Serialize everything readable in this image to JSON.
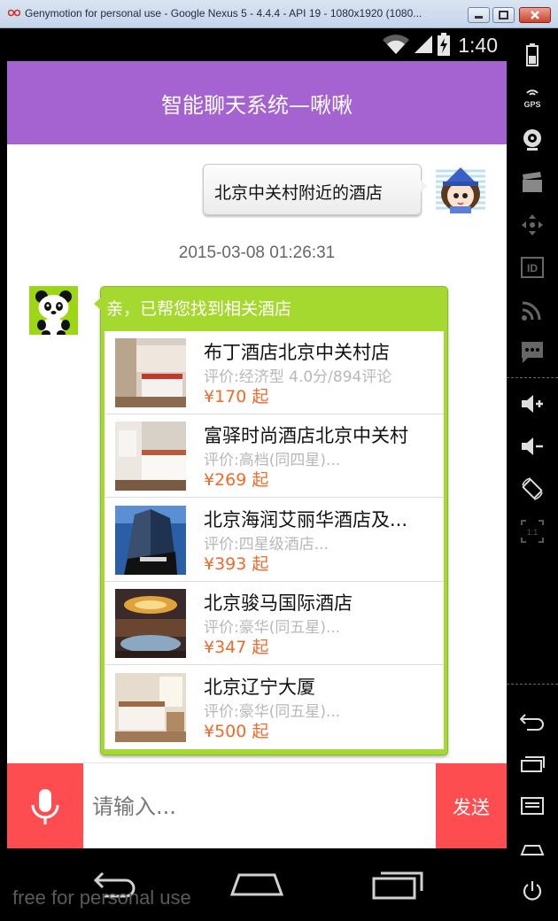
{
  "window": {
    "title": "Genymotion for personal use - Google Nexus 5 - 4.4.4 - API 19 - 1080x1920 (1080..."
  },
  "statusbar": {
    "clock": "1:40"
  },
  "app": {
    "title": "智能聊天系统—啾啾"
  },
  "chat": {
    "outgoing_text": "北京中关村附近的酒店",
    "timestamp": "2015-03-08 01:26:31",
    "reply_header": "亲，已帮您找到相关酒店",
    "hotels": [
      {
        "name": "布丁酒店北京中关村店",
        "rating": "评价:经济型  4.0分/894评论",
        "price": "¥170 起"
      },
      {
        "name": "富驿时尚酒店北京中关村",
        "rating": "评价:高档(同四星)...",
        "price": "¥269 起"
      },
      {
        "name": "北京海润艾丽华酒店及...",
        "rating": "评价:四星级酒店...",
        "price": "¥393 起"
      },
      {
        "name": "北京骏马国际酒店",
        "rating": "评价:豪华(同五星)...",
        "price": "¥347 起"
      },
      {
        "name": "北京辽宁大厦",
        "rating": "评价:豪华(同五星)...",
        "price": "¥500 起"
      }
    ]
  },
  "input": {
    "placeholder": "请输入...",
    "send_label": "发送"
  },
  "navbar": {
    "watermark": "free for personal use"
  },
  "toolpanel": {
    "items": [
      "battery-icon",
      "gps-icon",
      "webcam-icon",
      "clapperboard-icon",
      "dpad-icon",
      "id-icon",
      "cast-icon",
      "sms-icon",
      "volume-up-icon",
      "volume-down-icon",
      "rotate-icon",
      "pixel-perfect-icon",
      "back-icon",
      "recents-icon",
      "menu-icon",
      "home-icon",
      "power-icon"
    ],
    "gps_label": "GPS",
    "id_label": "ID",
    "pixel_label": "1:1"
  },
  "colors": {
    "appbar": "#a463d0",
    "accent_red": "#fd4d50",
    "reply_green": "#a6d92f",
    "price_orange": "#f06a2a"
  }
}
